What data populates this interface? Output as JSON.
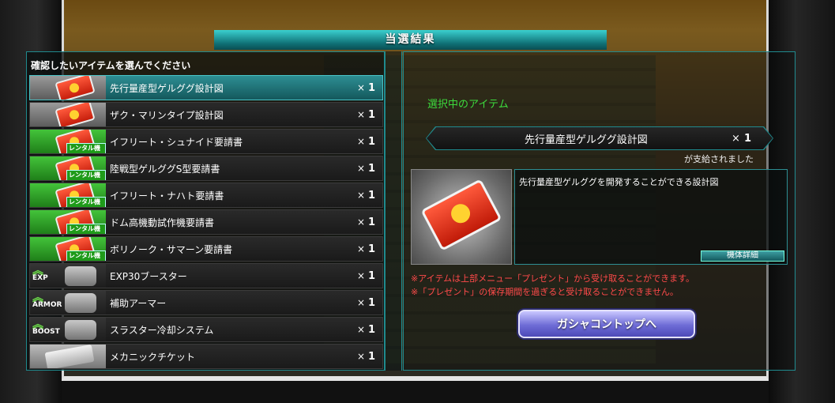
{
  "title": "当選結果",
  "left": {
    "header": "確認したいアイテムを選んでください",
    "items": [
      {
        "name": "先行量産型ゲルググ設計図",
        "x": "×",
        "qty": "1",
        "type": "blueprint",
        "selected": true
      },
      {
        "name": "ザク・マリンタイプ設計図",
        "x": "×",
        "qty": "1",
        "type": "blueprint"
      },
      {
        "name": "イフリート・シュナイド要請書",
        "x": "×",
        "qty": "1",
        "type": "rental",
        "tag": "レンタル機体"
      },
      {
        "name": "陸戦型ゲルググS型要請書",
        "x": "×",
        "qty": "1",
        "type": "rental",
        "tag": "レンタル機体"
      },
      {
        "name": "イフリート・ナハト要請書",
        "x": "×",
        "qty": "1",
        "type": "rental",
        "tag": "レンタル機体"
      },
      {
        "name": "ドム高機動試作機要請書",
        "x": "×",
        "qty": "1",
        "type": "rental",
        "tag": "レンタル機体"
      },
      {
        "name": "ボリノーク・サマーン要請書",
        "x": "×",
        "qty": "1",
        "type": "rental",
        "tag": "レンタル機体"
      },
      {
        "name": "EXP30ブースター",
        "x": "×",
        "qty": "1",
        "type": "badge",
        "badge": "EXP"
      },
      {
        "name": "補助アーマー",
        "x": "×",
        "qty": "1",
        "type": "badge",
        "badge": "ARMOR"
      },
      {
        "name": "スラスター冷却システム",
        "x": "×",
        "qty": "1",
        "type": "badge",
        "badge": "BOOST"
      },
      {
        "name": "メカニックチケット",
        "x": "×",
        "qty": "1",
        "type": "ticket"
      }
    ]
  },
  "right": {
    "selected_label": "選択中のアイテム",
    "item_name": "先行量産型ゲルググ設計図",
    "item_x": "×",
    "item_qty": "1",
    "supplied": "が支給されました",
    "description": "先行量産型ゲルググを開発することができる設計図",
    "detail_button": "機体詳細",
    "note1": "※アイテムは上部メニュー「プレゼント」から受け取ることができます。",
    "note2": "※「プレゼント」の保存期間を過ぎると受け取ることができません。",
    "gacha_button": "ガシャコントップへ"
  },
  "colors": {
    "accent": "#1f8a8e",
    "selected_label": "#3ddc3d",
    "note": "#ff4a4a",
    "gacha_button": "#6e6cd6"
  }
}
